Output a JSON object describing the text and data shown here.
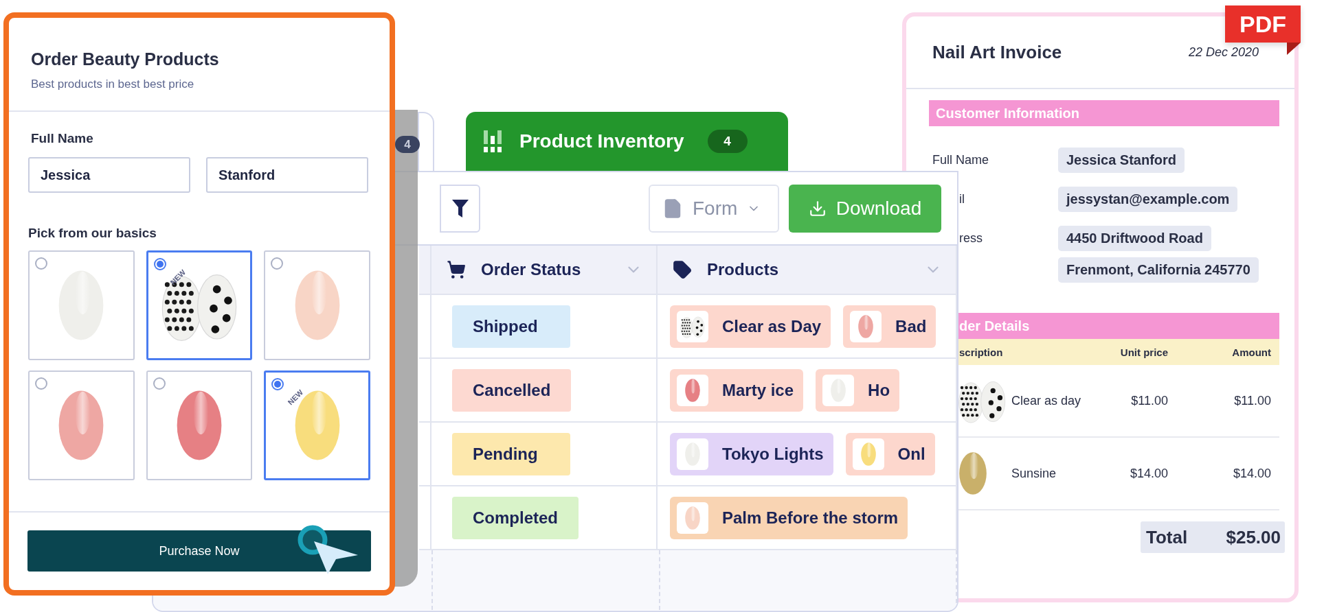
{
  "order_form": {
    "title": "Order Beauty Products",
    "subtitle": "Best products in best best price",
    "full_name_label": "Full Name",
    "first_name": "Jessica",
    "last_name": "Stanford",
    "pick_label": "Pick from our basics",
    "options": [
      {
        "selected": false,
        "nail": {
          "kind": "plain",
          "color": "#efefeb"
        }
      },
      {
        "selected": true,
        "badge": "NEW",
        "nail": {
          "kind": "polka",
          "color": "#f1f1ee"
        }
      },
      {
        "selected": false,
        "nail": {
          "kind": "plain",
          "color": "#f8d5c6"
        }
      },
      {
        "selected": false,
        "nail": {
          "kind": "plain",
          "color": "#eea7a3"
        }
      },
      {
        "selected": false,
        "nail": {
          "kind": "plain",
          "color": "#e68084"
        }
      },
      {
        "selected": true,
        "badge": "NEW",
        "nail": {
          "kind": "plain",
          "color": "#f8dd7d"
        }
      }
    ],
    "button": "Purchase Now"
  },
  "back_tab": {
    "badge": "4"
  },
  "inventory": {
    "tab": {
      "title": "Product Inventory",
      "badge": "4"
    },
    "toolbar": {
      "form_dropdown": "Form",
      "download": "Download"
    },
    "columns": [
      {
        "title": "Order Status",
        "kind": "cart"
      },
      {
        "title": "Products",
        "kind": "tag"
      }
    ],
    "rows": [
      {
        "status": {
          "label": "Shipped",
          "color": "#d8ecfa"
        },
        "products": [
          {
            "name": "Clear as Day",
            "color": "#fdd7cd",
            "nail": {
              "kind": "polka",
              "color": "#f1f1ee"
            }
          },
          {
            "name": "Bad",
            "color": "#fdd7cd",
            "nail": {
              "kind": "plain",
              "color": "#eea7a3"
            }
          }
        ]
      },
      {
        "status": {
          "label": "Cancelled",
          "color": "#fdd9d1"
        },
        "products": [
          {
            "name": "Marty ice",
            "color": "#fdd7cd",
            "nail": {
              "kind": "plain",
              "color": "#e68084"
            }
          },
          {
            "name": "Ho",
            "color": "#fdd7cd",
            "nail": {
              "kind": "plain",
              "color": "#efefeb"
            }
          }
        ]
      },
      {
        "status": {
          "label": "Pending",
          "color": "#fde8ad"
        },
        "products": [
          {
            "name": "Tokyo Lights",
            "color": "#e2d4f8",
            "nail": {
              "kind": "plain",
              "color": "#efefeb"
            }
          },
          {
            "name": "Onl",
            "color": "#fdd7cd",
            "nail": {
              "kind": "plain",
              "color": "#f8dd7d"
            }
          }
        ]
      },
      {
        "status": {
          "label": "Completed",
          "color": "#d9f3c9"
        },
        "products": [
          {
            "name": "Palm Before the storm",
            "color": "#f9d4b3",
            "nail": {
              "kind": "plain",
              "color": "#f8d5c6"
            }
          }
        ]
      }
    ]
  },
  "invoice": {
    "badge": "PDF",
    "title": "Nail Art Invoice",
    "date": "22 Dec 2020",
    "customer_heading": {
      "text": "Customer Information",
      "clipped": false
    },
    "fields": [
      {
        "label": "Full Name",
        "clipped": false,
        "values": [
          "Jessica Stanford"
        ]
      },
      {
        "label": "il",
        "clipped": true,
        "values": [
          "jessystan@example.com"
        ]
      },
      {
        "label": "ress",
        "clipped": true,
        "values": [
          "4450 Driftwood Road",
          "Frenmont, California 245770"
        ]
      }
    ],
    "order_heading": {
      "text": "der Details",
      "clipped": true
    },
    "columns": [
      {
        "label": "scription",
        "clipped": true
      },
      {
        "label": "Unit price"
      },
      {
        "label": "Amount"
      }
    ],
    "items": [
      {
        "nail": {
          "kind": "polka",
          "color": "#f1f1ee"
        },
        "description": "Clear as day",
        "unit_price": "$11.00",
        "amount": "$11.00"
      },
      {
        "nail": {
          "kind": "plain",
          "color": "#c9b06a"
        },
        "description": "Sunsine",
        "unit_price": "$14.00",
        "amount": "$14.00"
      }
    ],
    "total_label": "Total",
    "total": "$25.00"
  }
}
